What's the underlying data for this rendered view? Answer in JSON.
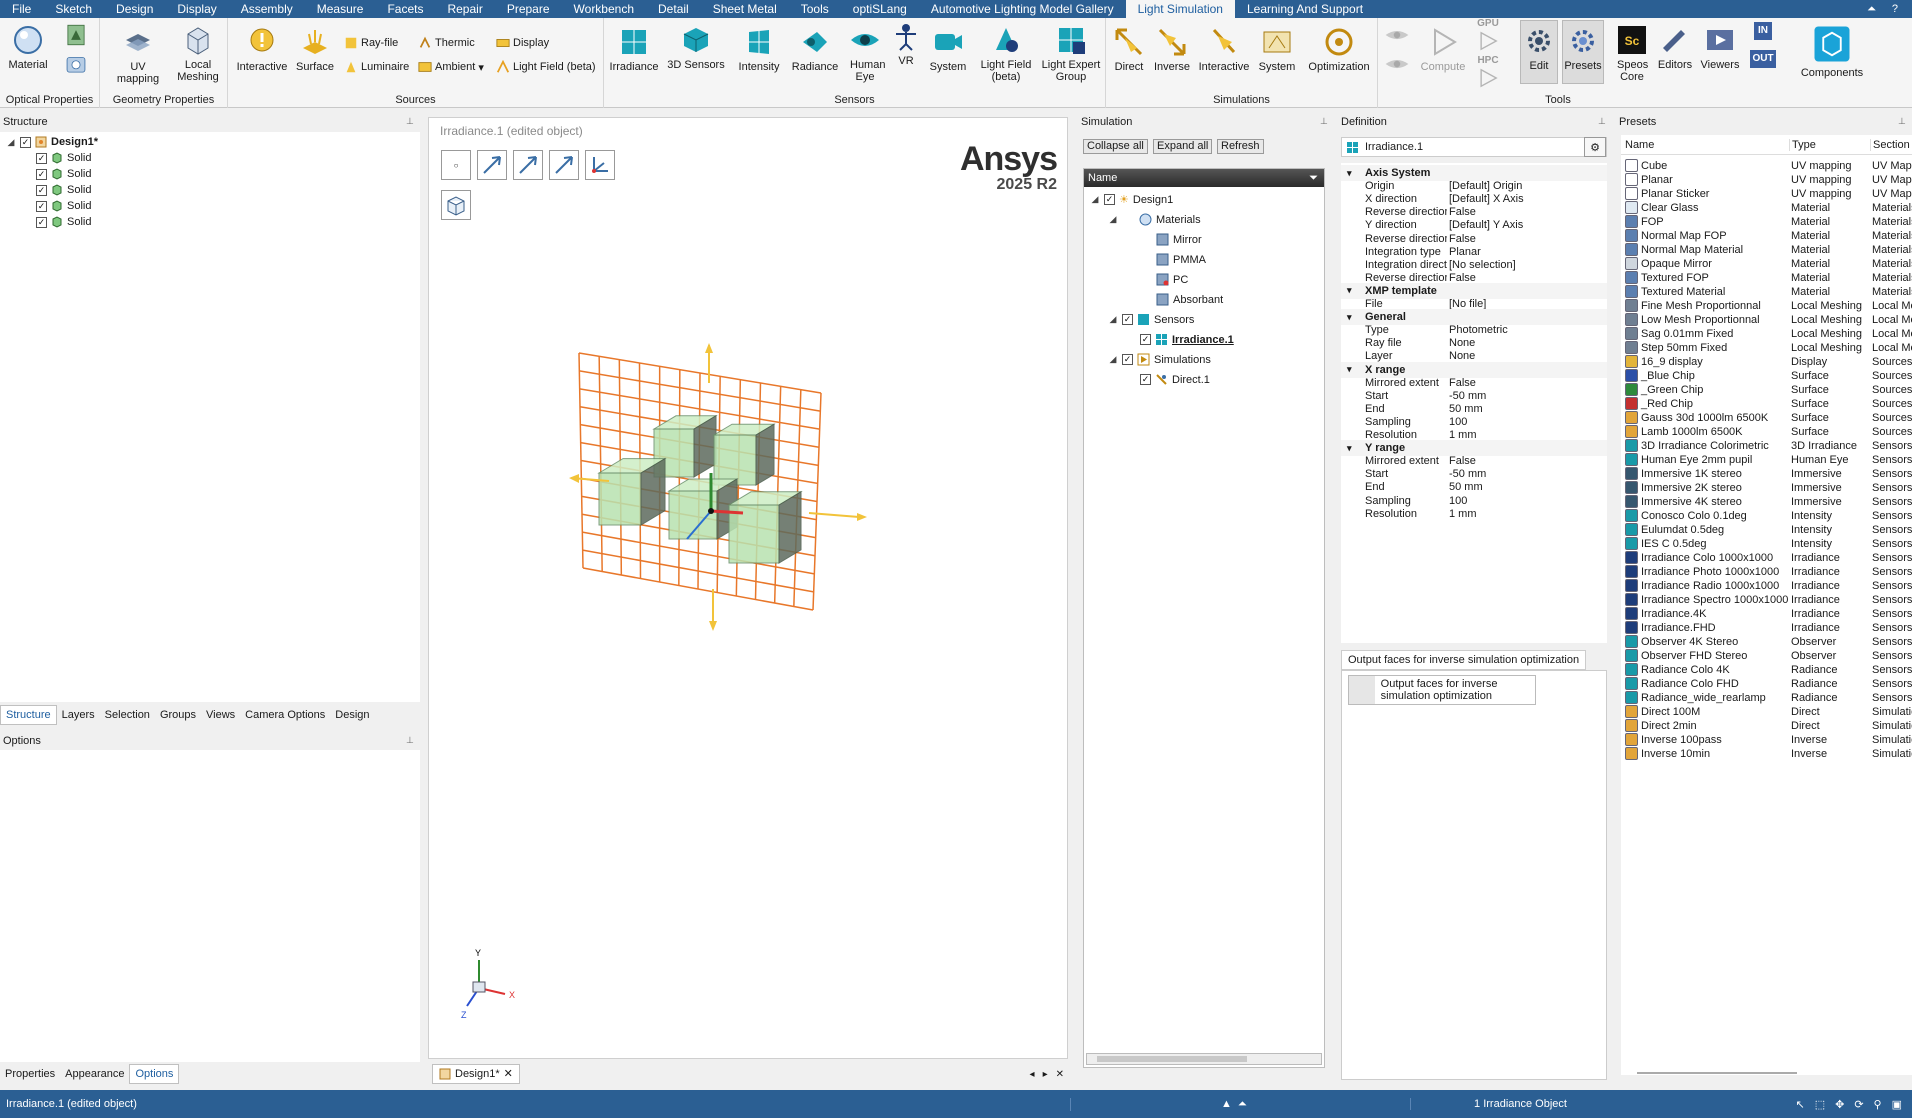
{
  "menu": {
    "tabs": [
      "File",
      "Sketch",
      "Design",
      "Display",
      "Assembly",
      "Measure",
      "Facets",
      "Repair",
      "Prepare",
      "Workbench",
      "Detail",
      "Sheet Metal",
      "Tools",
      "optiSLang",
      "Automotive Lighting Model Gallery",
      "Light Simulation",
      "Learning And Support"
    ],
    "active_tab": "Light Simulation"
  },
  "ribbon": {
    "groups": {
      "optical": "Optical Properties",
      "geometry": "Geometry Properties",
      "sources": "Sources",
      "sensors": "Sensors",
      "simulations": "Simulations",
      "tools": "Tools"
    },
    "buttons": {
      "material": "Material",
      "uv_mapping": "UV mapping",
      "local_meshing": "Local Meshing",
      "interactive_src": "Interactive",
      "surface": "Surface",
      "ray_file": "Ray-file",
      "thermic": "Thermic",
      "display": "Display",
      "luminaire": "Luminaire",
      "ambient": "Ambient",
      "light_field_beta": "Light Field (beta)",
      "irradiance": "Irradiance",
      "sensors_3d": "3D Sensors",
      "intensity": "Intensity",
      "radiance": "Radiance",
      "human_eye": "Human Eye",
      "vr": "VR",
      "system_sensor": "System",
      "light_field_sensor": "Light Field (beta)",
      "light_expert_group": "Light Expert Group",
      "direct": "Direct",
      "inverse": "Inverse",
      "interactive_sim": "Interactive",
      "system_sim": "System",
      "optimization": "Optimization",
      "compute": "Compute",
      "gpu": "GPU",
      "hpc": "HPC",
      "edit": "Edit",
      "presets": "Presets",
      "speos_core": "Speos Core",
      "editors": "Editors",
      "viewers": "Viewers",
      "in": "IN",
      "out": "OUT",
      "components": "Components"
    }
  },
  "structure": {
    "title": "Structure",
    "root": "Design1*",
    "items": [
      "Solid",
      "Solid",
      "Solid",
      "Solid",
      "Solid"
    ]
  },
  "left_tabs": [
    "Structure",
    "Layers",
    "Selection",
    "Groups",
    "Views",
    "Camera Options",
    "Design"
  ],
  "left_tabs_active": "Structure",
  "options": {
    "title": "Options"
  },
  "bottom_left_tabs": [
    "Properties",
    "Appearance",
    "Options"
  ],
  "bottom_left_active": "Options",
  "viewport": {
    "title": "Irradiance.1 (edited object)",
    "brand": "Ansys",
    "version": "2025 R2",
    "tab": "Design1*",
    "axis_x": "X",
    "axis_y": "Y",
    "axis_z": "Z"
  },
  "simulation": {
    "title": "Simulation",
    "collapse_all": "Collapse all",
    "expand_all": "Expand all",
    "refresh": "Refresh",
    "column_name": "Name",
    "tree": {
      "design": "Design1",
      "materials": "Materials",
      "mirror": "Mirror",
      "pmma": "PMMA",
      "pc": "PC",
      "absorbant": "Absorbant",
      "sensors": "Sensors",
      "irradiance": "Irradiance.1",
      "simulations": "Simulations",
      "direct": "Direct.1"
    }
  },
  "definition": {
    "title": "Definition",
    "object_name": "Irradiance.1",
    "rows": [
      {
        "k": "Axis System",
        "v": "",
        "cat": true
      },
      {
        "k": "Origin",
        "v": "[Default] Origin"
      },
      {
        "k": "X direction",
        "v": "[Default] X Axis"
      },
      {
        "k": "Reverse direction",
        "v": "False"
      },
      {
        "k": "Y direction",
        "v": "[Default] Y Axis"
      },
      {
        "k": "Reverse direction",
        "v": "False"
      },
      {
        "k": "Integration type",
        "v": "Planar"
      },
      {
        "k": "Integration direction",
        "v": "[No selection]"
      },
      {
        "k": "Reverse direction",
        "v": "False"
      },
      {
        "k": "XMP template",
        "v": "",
        "cat": true
      },
      {
        "k": "File",
        "v": "[No file]"
      },
      {
        "k": "General",
        "v": "",
        "cat": true
      },
      {
        "k": "Type",
        "v": "Photometric"
      },
      {
        "k": "Ray file",
        "v": "None"
      },
      {
        "k": "Layer",
        "v": "None"
      },
      {
        "k": "X range",
        "v": "",
        "cat": true
      },
      {
        "k": "Mirrored extent",
        "v": "False"
      },
      {
        "k": "Start",
        "v": "-50 mm"
      },
      {
        "k": "End",
        "v": "50 mm"
      },
      {
        "k": "Sampling",
        "v": "100"
      },
      {
        "k": "Resolution",
        "v": "1 mm"
      },
      {
        "k": "Y range",
        "v": "",
        "cat": true
      },
      {
        "k": "Mirrored extent",
        "v": "False"
      },
      {
        "k": "Start",
        "v": "-50 mm"
      },
      {
        "k": "End",
        "v": "50 mm"
      },
      {
        "k": "Sampling",
        "v": "100"
      },
      {
        "k": "Resolution",
        "v": "1 mm"
      }
    ],
    "output_tab": "Output faces for inverse simulation optimization",
    "output_btn": "Output faces for inverse simulation optimization"
  },
  "presets": {
    "title": "Presets",
    "col_name": "Name",
    "col_type": "Type",
    "col_section": "Section",
    "items": [
      {
        "n": "Cube",
        "t": "UV mapping",
        "s": "UV Mapp",
        "c": "#ffffff"
      },
      {
        "n": "Planar",
        "t": "UV mapping",
        "s": "UV Mapp",
        "c": "#ffffff"
      },
      {
        "n": "Planar Sticker",
        "t": "UV mapping",
        "s": "UV Mapp",
        "c": "#ffffff"
      },
      {
        "n": "Clear Glass",
        "t": "Material",
        "s": "Materials",
        "c": "#dfe9f2"
      },
      {
        "n": "FOP",
        "t": "Material",
        "s": "Materials",
        "c": "#5b7fb0"
      },
      {
        "n": "Normal Map FOP",
        "t": "Material",
        "s": "Materials",
        "c": "#5b7fb0"
      },
      {
        "n": "Normal Map Material",
        "t": "Material",
        "s": "Materials",
        "c": "#5b7fb0"
      },
      {
        "n": "Opaque Mirror",
        "t": "Material",
        "s": "Materials",
        "c": "#cfd6de"
      },
      {
        "n": "Textured FOP",
        "t": "Material",
        "s": "Materials",
        "c": "#5b7fb0"
      },
      {
        "n": "Textured Material",
        "t": "Material",
        "s": "Materials",
        "c": "#5b7fb0"
      },
      {
        "n": "Fine Mesh Proportionnal",
        "t": "Local Meshing",
        "s": "Local Me",
        "c": "#6f7f92"
      },
      {
        "n": "Low Mesh Proportionnal",
        "t": "Local Meshing",
        "s": "Local Me",
        "c": "#6f7f92"
      },
      {
        "n": "Sag 0.01mm Fixed",
        "t": "Local Meshing",
        "s": "Local Me",
        "c": "#6f7f92"
      },
      {
        "n": "Step 50mm Fixed",
        "t": "Local Meshing",
        "s": "Local Me",
        "c": "#6f7f92"
      },
      {
        "n": "16_9 display",
        "t": "Display",
        "s": "Sources",
        "c": "#e2b43a"
      },
      {
        "n": "_Blue Chip",
        "t": "Surface",
        "s": "Sources",
        "c": "#2b4fa8"
      },
      {
        "n": "_Green Chip",
        "t": "Surface",
        "s": "Sources",
        "c": "#2e8a3c"
      },
      {
        "n": "_Red Chip",
        "t": "Surface",
        "s": "Sources",
        "c": "#c43030"
      },
      {
        "n": "Gauss 30d 1000lm 6500K",
        "t": "Surface",
        "s": "Sources",
        "c": "#e2a53a"
      },
      {
        "n": "Lamb 1000lm 6500K",
        "t": "Surface",
        "s": "Sources",
        "c": "#e2a53a"
      },
      {
        "n": "3D Irradiance Colorimetric",
        "t": "3D Irradiance",
        "s": "Sensors",
        "c": "#1a9aa8"
      },
      {
        "n": "Human Eye 2mm pupil",
        "t": "Human Eye",
        "s": "Sensors",
        "c": "#1a9aa8"
      },
      {
        "n": "Immersive 1K stereo",
        "t": "Immersive",
        "s": "Sensors",
        "c": "#36576f"
      },
      {
        "n": "Immersive 2K stereo",
        "t": "Immersive",
        "s": "Sensors",
        "c": "#36576f"
      },
      {
        "n": "Immersive 4K stereo",
        "t": "Immersive",
        "s": "Sensors",
        "c": "#36576f"
      },
      {
        "n": "Conosco Colo 0.1deg",
        "t": "Intensity",
        "s": "Sensors",
        "c": "#1a9aa8"
      },
      {
        "n": "Eulumdat 0.5deg",
        "t": "Intensity",
        "s": "Sensors",
        "c": "#1a9aa8"
      },
      {
        "n": "IES C 0.5deg",
        "t": "Intensity",
        "s": "Sensors",
        "c": "#1a9aa8"
      },
      {
        "n": "Irradiance Colo 1000x1000",
        "t": "Irradiance",
        "s": "Sensors",
        "c": "#1e3d7a"
      },
      {
        "n": "Irradiance Photo 1000x1000",
        "t": "Irradiance",
        "s": "Sensors",
        "c": "#1e3d7a"
      },
      {
        "n": "Irradiance Radio 1000x1000",
        "t": "Irradiance",
        "s": "Sensors",
        "c": "#1e3d7a"
      },
      {
        "n": "Irradiance Spectro 1000x1000",
        "t": "Irradiance",
        "s": "Sensors",
        "c": "#1e3d7a"
      },
      {
        "n": "Irradiance.4K",
        "t": "Irradiance",
        "s": "Sensors",
        "c": "#1e3d7a"
      },
      {
        "n": "Irradiance.FHD",
        "t": "Irradiance",
        "s": "Sensors",
        "c": "#1e3d7a"
      },
      {
        "n": "Observer 4K Stereo",
        "t": "Observer",
        "s": "Sensors",
        "c": "#1a9aa8"
      },
      {
        "n": "Observer FHD Stereo",
        "t": "Observer",
        "s": "Sensors",
        "c": "#1a9aa8"
      },
      {
        "n": "Radiance Colo 4K",
        "t": "Radiance",
        "s": "Sensors",
        "c": "#1a9aa8"
      },
      {
        "n": "Radiance Colo FHD",
        "t": "Radiance",
        "s": "Sensors",
        "c": "#1a9aa8"
      },
      {
        "n": "Radiance_wide_rearlamp",
        "t": "Radiance",
        "s": "Sensors",
        "c": "#1a9aa8"
      },
      {
        "n": "Direct 100M",
        "t": "Direct",
        "s": "Simulatic",
        "c": "#e2a53a"
      },
      {
        "n": "Direct 2min",
        "t": "Direct",
        "s": "Simulatic",
        "c": "#e2a53a"
      },
      {
        "n": "Inverse 100pass",
        "t": "Inverse",
        "s": "Simulatic",
        "c": "#e2a53a"
      },
      {
        "n": "Inverse 10min",
        "t": "Inverse",
        "s": "Simulatic",
        "c": "#e2a53a"
      }
    ]
  },
  "status": {
    "left": "Irradiance.1 (edited object)",
    "center": "1 Irradiance Object"
  },
  "colors": {
    "menubar": "#2b5f93",
    "grid": "#e8772a",
    "solid": "#b8e2b0",
    "accent": "#1f5fa0"
  }
}
